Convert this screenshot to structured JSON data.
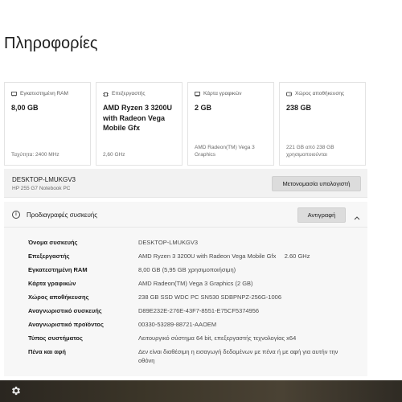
{
  "page": {
    "title": "Πληροφορίες"
  },
  "cards": [
    {
      "icon": "memory-icon",
      "label": "Εγκατεστημένη RAM",
      "value": "8,00 GB",
      "sub": "Ταχύτητα: 2400 MHz"
    },
    {
      "icon": "processor-icon",
      "label": "Επεξεργαστής",
      "value": "AMD Ryzen 3 3200U with Radeon Vega Mobile Gfx",
      "sub": "2,60 GHz"
    },
    {
      "icon": "graphics-card-icon",
      "label": "Κάρτα γραφικών",
      "value": "2 GB",
      "sub": "AMD Radeon(TM) Vega 3 Graphics"
    },
    {
      "icon": "storage-icon",
      "label": "Χώρος αποθήκευσης",
      "value": "238 GB",
      "sub": "221 GB από 238 GB χρησιμοποιούνται"
    }
  ],
  "device": {
    "name": "DESKTOP-LMUKGV3",
    "model": "HP 255 G7 Notebook PC",
    "rename_label": "Μετονομασία υπολογιστή"
  },
  "specs": {
    "title": "Προδιαγραφές συσκευής",
    "copy_label": "Αντιγραφή",
    "rows": [
      {
        "label": "Όνομα συσκευής",
        "value": "DESKTOP-LMUKGV3"
      },
      {
        "label": "Επεξεργαστής",
        "value": "AMD Ryzen 3 3200U with Radeon Vega Mobile Gfx     2.60 GHz"
      },
      {
        "label": "Εγκατεστημένη RAM",
        "value": "8,00 GB (5,95 GB χρησιμοποιήσιμη)"
      },
      {
        "label": "Κάρτα γραφικών",
        "value": "AMD Radeon(TM) Vega 3 Graphics (2 GB)"
      },
      {
        "label": "Χώρος αποθήκευσης",
        "value": "238 GB SSD WDC PC SN530 SDBPNPZ-256G-1006"
      },
      {
        "label": "Αναγνωριστικό συσκευής",
        "value": "D89E232E-276E-43F7-8551-E75CF5374956"
      },
      {
        "label": "Αναγνωριστικό προϊόντος",
        "value": "00330-53289-88721-AAOEM"
      },
      {
        "label": "Τύπος συστήματος",
        "value": "Λειτουργικό σύστημα 64 bit, επεξεργαστής τεχνολογίας x64"
      },
      {
        "label": "Πένα και αφή",
        "value": "Δεν είναι διαθέσιμη η εισαγωγή δεδομένων με πένα ή με αφή για αυτήν την οθόνη"
      }
    ]
  },
  "footer": {
    "icon": "gear-icon"
  }
}
